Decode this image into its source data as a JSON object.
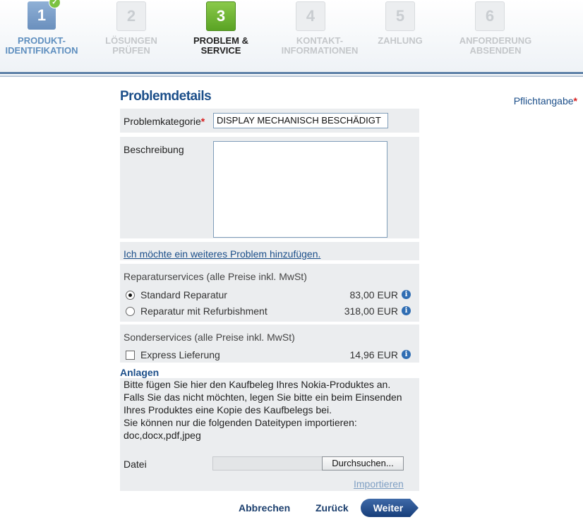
{
  "wizard": {
    "steps": [
      {
        "number": "1",
        "label1": "PRODUKT-",
        "label2": "IDENTIFIKATION",
        "state": "done"
      },
      {
        "number": "2",
        "label1": "LÖSUNGEN",
        "label2": "PRÜFEN",
        "state": "todo"
      },
      {
        "number": "3",
        "label1": "PROBLEM &",
        "label2": "SERVICE",
        "state": "active"
      },
      {
        "number": "4",
        "label1": "KONTAKT-",
        "label2": "INFORMATIONEN",
        "state": "todo"
      },
      {
        "number": "5",
        "label1": "ZAHLUNG",
        "label2": "",
        "state": "todo"
      },
      {
        "number": "6",
        "label1": "ANFORDERUNG",
        "label2": "ABSENDEN",
        "state": "todo"
      }
    ]
  },
  "form": {
    "title": "Problemdetails",
    "required_note": "Pflichtangabe",
    "required_star": "*",
    "category_label": "Problemkategorie",
    "category_value": "DISPLAY MECHANISCH BESCHÄDIGT",
    "description_label": "Beschreibung",
    "add_problem_link": "Ich möchte ein weiteres Problem hinzufügen.",
    "repair_section": "Reparaturservices (alle Preise inkl. MwSt)",
    "repair_options": [
      {
        "label": "Standard Reparatur",
        "price": "83,00 EUR",
        "selected": true
      },
      {
        "label": "Reparatur mit Refurbishment",
        "price": "318,00 EUR",
        "selected": false
      }
    ],
    "special_section": "Sonderservices (alle Preise inkl. MwSt)",
    "special_options": [
      {
        "label": "Express Lieferung",
        "price": "14,96 EUR",
        "checked": false
      }
    ],
    "info_glyph": "i"
  },
  "attachments": {
    "title": "Anlagen",
    "text_lines": [
      "Bitte fügen Sie hier den Kaufbeleg Ihres Nokia-Produktes an.",
      "Falls Sie das nicht möchten, legen Sie bitte ein beim Einsenden",
      "Ihres Produktes eine Kopie des Kaufbelegs bei.",
      "Sie können nur die folgenden Dateitypen importieren:",
      "doc,docx,pdf,jpeg"
    ],
    "file_label": "Datei",
    "browse_label": "Durchsuchen...",
    "import_link": "Importieren"
  },
  "actions": {
    "cancel": "Abbrechen",
    "back": "Zurück",
    "next": "Weiter"
  },
  "colors": {
    "brand_blue": "#1c4f8a",
    "active_step": "#6ab530",
    "done_step": "#7a9dc8",
    "required": "#d81e1e"
  }
}
